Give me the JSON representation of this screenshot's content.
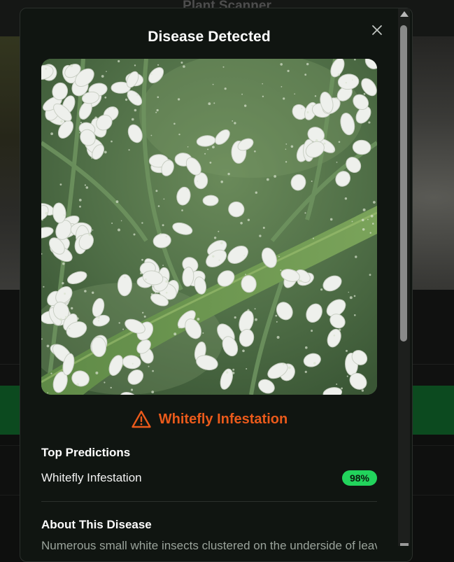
{
  "app": {
    "title": "Plant Scanner"
  },
  "modal": {
    "title": "Disease Detected",
    "close_icon": "close-icon",
    "image_subject": "leaf-with-whiteflies",
    "diagnosis": {
      "name": "Whitefly Infestation",
      "icon": "warning-triangle-icon",
      "color": "#ea5a1b"
    },
    "top_predictions": {
      "title": "Top Predictions",
      "items": [
        {
          "label": "Whitefly Infestation",
          "confidence": "98%"
        }
      ]
    },
    "about": {
      "title": "About This Disease",
      "text": "Numerous small white insects clustered on the underside of leaves"
    }
  },
  "colors": {
    "accent_orange": "#ea5a1b",
    "badge_green": "#22d45c",
    "modal_bg": "#101511"
  }
}
